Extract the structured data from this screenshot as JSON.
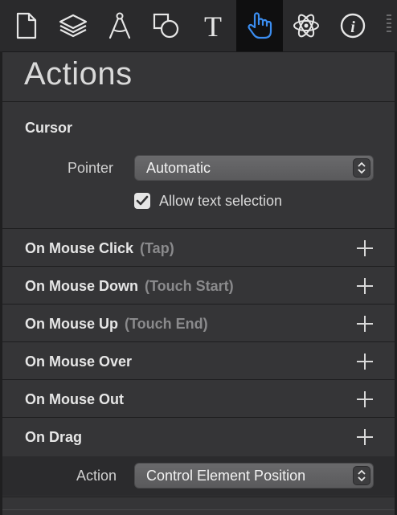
{
  "toolbar": {
    "tools": [
      {
        "icon": "document-icon"
      },
      {
        "icon": "layers-icon"
      },
      {
        "icon": "compass-icon"
      },
      {
        "icon": "shapes-icon"
      },
      {
        "icon": "text-icon",
        "glyph": "T"
      },
      {
        "icon": "hand-pointer-icon",
        "active": true
      },
      {
        "icon": "atom-icon"
      },
      {
        "icon": "info-icon",
        "glyph": "i"
      }
    ]
  },
  "panel": {
    "title": "Actions"
  },
  "cursor": {
    "heading": "Cursor",
    "pointer_label": "Pointer",
    "pointer_value": "Automatic",
    "allow_text_selection_label": "Allow text selection",
    "allow_text_selection_checked": true
  },
  "events": [
    {
      "name": "On Mouse Click",
      "sub": "(Tap)"
    },
    {
      "name": "On Mouse Down",
      "sub": "(Touch Start)"
    },
    {
      "name": "On Mouse Up",
      "sub": "(Touch End)"
    },
    {
      "name": "On Mouse Over",
      "sub": ""
    },
    {
      "name": "On Mouse Out",
      "sub": ""
    },
    {
      "name": "On Drag",
      "sub": ""
    }
  ],
  "drag_action": {
    "label": "Action",
    "value": "Control Element Position"
  },
  "colors": {
    "panel_bg": "#353537",
    "toolbar_bg": "#2a2a2c",
    "active_tool_bg": "#0f0f10",
    "accent_blue": "#3b8df0"
  }
}
